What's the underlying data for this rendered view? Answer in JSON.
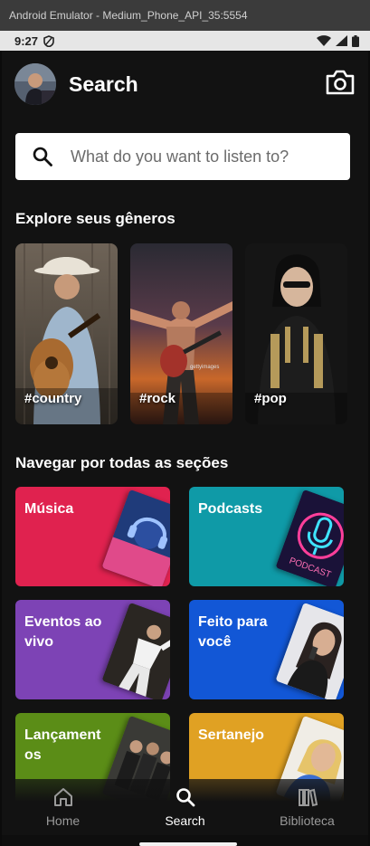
{
  "emulator": {
    "title": "Android Emulator - Medium_Phone_API_35:5554"
  },
  "status_bar": {
    "time": "9:27"
  },
  "header": {
    "title": "Search"
  },
  "search": {
    "placeholder": "What do you want to listen to?"
  },
  "genres_section": {
    "title": "Explore seus gêneros",
    "items": [
      {
        "tag": "#country",
        "icon": "country-artist-photo"
      },
      {
        "tag": "#rock",
        "icon": "rock-artist-photo"
      },
      {
        "tag": "#pop",
        "icon": "pop-artist-photo"
      }
    ]
  },
  "browse_section": {
    "title": "Navegar por todas as seções",
    "tiles": [
      {
        "label": "Música",
        "color": "#e0224f"
      },
      {
        "label": "Podcasts",
        "color": "#0f9aa7"
      },
      {
        "label": "Eventos ao\nvivo",
        "color": "#7d43b5"
      },
      {
        "label": "Feito para\nvocê",
        "color": "#1257d6"
      },
      {
        "label": "Lançament\nos",
        "color": "#5b8d17"
      },
      {
        "label": "Sertanejo",
        "color": "#e0a123"
      }
    ]
  },
  "bottom_nav": {
    "items": [
      {
        "label": "Home",
        "icon": "home-icon"
      },
      {
        "label": "Search",
        "icon": "search-icon"
      },
      {
        "label": "Biblioteca",
        "icon": "library-icon"
      }
    ]
  }
}
